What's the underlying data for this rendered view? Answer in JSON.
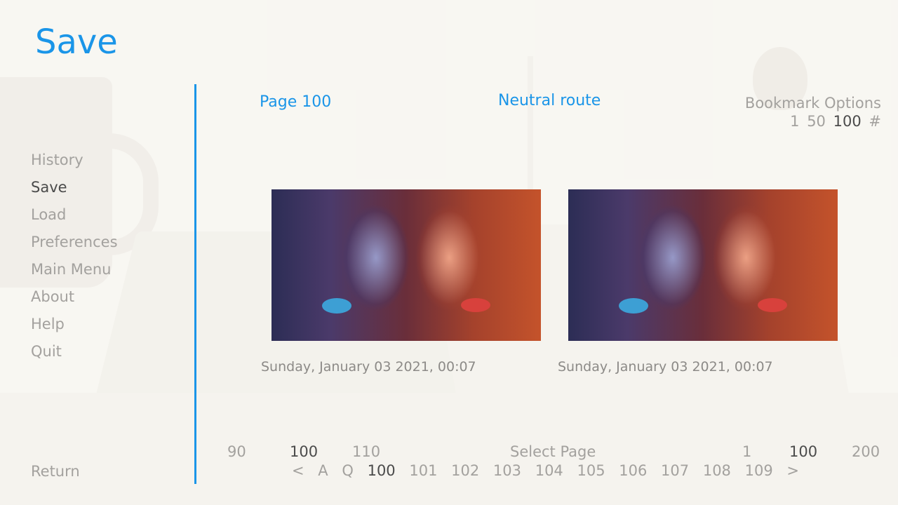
{
  "screen_title": "Save",
  "nav": {
    "items": [
      {
        "label": "History"
      },
      {
        "label": "Save"
      },
      {
        "label": "Load"
      },
      {
        "label": "Preferences"
      },
      {
        "label": "Main Menu"
      },
      {
        "label": "About"
      },
      {
        "label": "Help"
      },
      {
        "label": "Quit"
      }
    ],
    "active": "Save",
    "return_label": "Return"
  },
  "header": {
    "page_label": "Page 100",
    "route_label": "Neutral route"
  },
  "bookmarks": {
    "title": "Bookmark Options",
    "options": [
      "1",
      "50",
      "100",
      "#"
    ],
    "selected": "100"
  },
  "slots": [
    {
      "timestamp": "Sunday, January 03 2021, 00:07"
    },
    {
      "timestamp": "Sunday, January 03 2021, 00:07"
    }
  ],
  "pager": {
    "jump_left": [
      "90",
      "100",
      "110"
    ],
    "select_label": "Select Page",
    "jump_right": [
      "1",
      "100",
      "200"
    ],
    "nav": [
      "<",
      "A",
      "Q",
      "100",
      "101",
      "102",
      "103",
      "104",
      "105",
      "106",
      "107",
      "108",
      "109",
      ">"
    ],
    "current": "100"
  },
  "colors": {
    "accent": "#1a95e8",
    "text_idle": "#a3a19e",
    "text_selected": "#4b4b4b"
  }
}
